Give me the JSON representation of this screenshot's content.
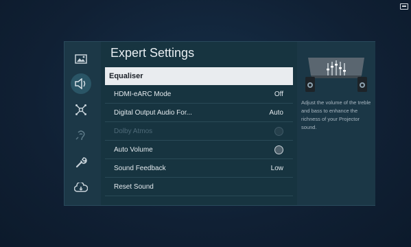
{
  "title": "Expert Settings",
  "menu": [
    {
      "label": "Equaliser",
      "value": "",
      "control": "none",
      "state": "focused"
    },
    {
      "label": "HDMI-eARC Mode",
      "value": "Off",
      "control": "text",
      "state": "normal"
    },
    {
      "label": "Digital Output Audio For...",
      "value": "Auto",
      "control": "text",
      "state": "normal"
    },
    {
      "label": "Dolby Atmos",
      "value": "",
      "control": "toggle",
      "state": "disabled"
    },
    {
      "label": "Auto Volume",
      "value": "",
      "control": "toggle",
      "state": "normal"
    },
    {
      "label": "Sound Feedback",
      "value": "Low",
      "control": "text",
      "state": "normal"
    },
    {
      "label": "Reset Sound",
      "value": "",
      "control": "none",
      "state": "normal"
    }
  ],
  "side_icons": [
    {
      "name": "picture-icon",
      "active": false
    },
    {
      "name": "sound-icon",
      "active": true
    },
    {
      "name": "connection-icon",
      "active": false
    },
    {
      "name": "accessibility-icon",
      "active": false
    },
    {
      "name": "support-icon",
      "active": false
    },
    {
      "name": "cloud-icon",
      "active": false
    }
  ],
  "info": {
    "description": "Adjust the volume of the treble and bass to enhance the richness of your Projector sound."
  },
  "colors": {
    "focus_bg": "#e9ecef",
    "panel_bg": "#16303f",
    "accent": "#2a5566"
  }
}
